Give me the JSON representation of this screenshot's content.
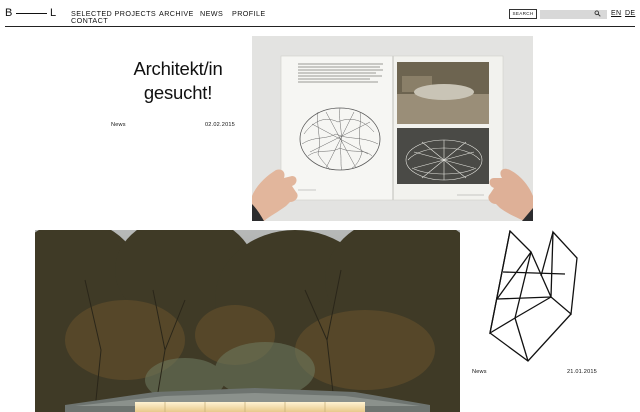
{
  "header": {
    "logo": {
      "left": "B",
      "right": "L"
    },
    "nav": [
      "SELECTED PROJECTS",
      "ARCHIVE",
      "NEWS",
      "PROFILE",
      "CONTACT"
    ],
    "search": {
      "button_label": "SEARCH",
      "placeholder": ""
    },
    "languages": [
      "EN",
      "DE"
    ],
    "active_language": "EN"
  },
  "posts": [
    {
      "title": "Architekt/in gesucht!",
      "category": "News",
      "date": "02.02.2015"
    },
    {
      "category": "News",
      "date": "21.01.2015"
    }
  ],
  "icons": [
    "search-icon",
    "geometric-logo-mark"
  ],
  "colors": {
    "text": "#111111",
    "search_field": "#d8d8d8",
    "background": "#ffffff"
  }
}
